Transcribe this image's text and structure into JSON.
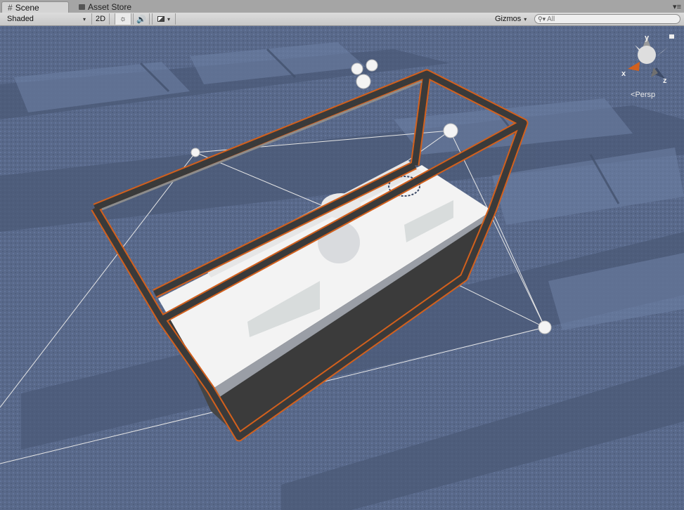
{
  "tabs": {
    "scene_label": "Scene",
    "asset_store_label": "Asset Store",
    "scene_icon": "hash-icon",
    "asset_store_icon": "shopping-bag-icon"
  },
  "toolbar": {
    "shading_mode": "Shaded",
    "toggle_2d": "2D",
    "lighting_icon": "sun-icon",
    "audio_icon": "speaker-icon",
    "effects_icon": "image-icon",
    "gizmos_label": "Gizmos",
    "search_placeholder": "All"
  },
  "gizmo": {
    "axis_y": "y",
    "axis_x": "x",
    "axis_z": "z",
    "projection": "Persp"
  },
  "colors": {
    "selection_outline": "#d2601d",
    "ground": "#5a6c8a",
    "display_case_frame": "#3a3a3a"
  }
}
